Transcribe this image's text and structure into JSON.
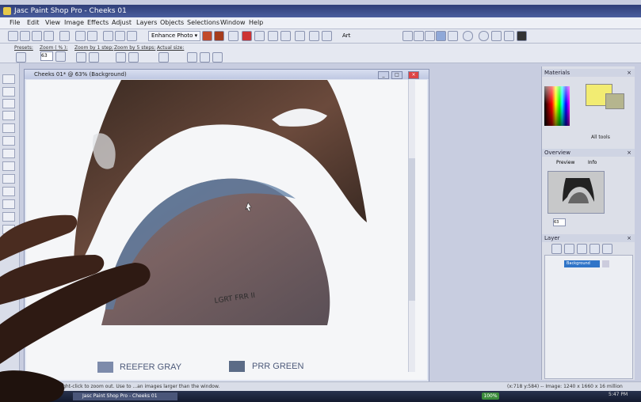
{
  "window": {
    "title": "Jasc Paint Shop Pro - Cheeks 01"
  },
  "menu": [
    "File",
    "Edit",
    "View",
    "Image",
    "Effects",
    "Adjust",
    "Layers",
    "Objects",
    "Selections",
    "Window",
    "Help"
  ],
  "toolbar": {
    "enhance_label": "Enhance Photo ▾",
    "art_label": "Art"
  },
  "tool_options": {
    "presets": "Presets:",
    "zoom_pct": "Zoom ( % ):",
    "zoom_value": "63",
    "zoom_step": "Zoom by 1 step:",
    "zoom_5": "Zoom by 5 steps:",
    "actual": "Actual size:"
  },
  "document": {
    "title": "Cheeks 01* @ 63% (Background)"
  },
  "canvas_labels": {
    "left": "REEFER GRAY",
    "right": "PRR GREEN",
    "pencil": "LGRT FRR II"
  },
  "materials": {
    "title": "Materials",
    "all_tools": "All tools"
  },
  "overview": {
    "title": "Overview",
    "preview_tab": "Preview",
    "info_tab": "Info",
    "zoom": "63"
  },
  "layers": {
    "title": "Layer",
    "row": "Background"
  },
  "status": {
    "left": "n Tool: Click to zoom in, right-click to zoom out. Use to ...an images larger than the window.",
    "right": "(x:718 y:584) -- Image: 1240 x 1660 x 16 million"
  },
  "taskbar": {
    "item": "Jasc Paint Shop Pro - Cheeks 01",
    "zoom": "100%",
    "time": "5:47 PM"
  },
  "colors": {
    "reefer_gray": "#7d8bab",
    "prr_green": "#5b6b86",
    "fg": "#f2ec72"
  }
}
